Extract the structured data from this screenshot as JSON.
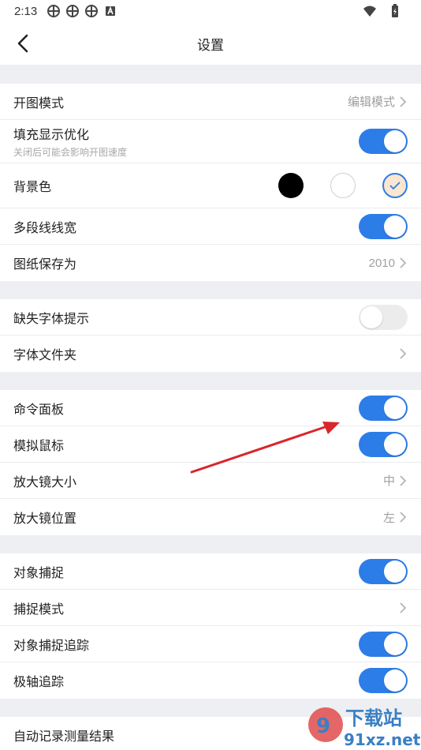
{
  "status_bar": {
    "time": "2:13"
  },
  "header": {
    "title": "设置"
  },
  "sections": [
    {
      "items": [
        {
          "label": "开图模式",
          "value": "编辑模式"
        },
        {
          "label": "填充显示优化",
          "sublabel": "关闭后可能会影响开图速度",
          "toggle": true
        },
        {
          "label": "背景色",
          "swatches": [
            "#000000",
            "#ffffff",
            "#fbe6cf"
          ],
          "selected": 2
        },
        {
          "label": "多段线线宽",
          "toggle": true
        },
        {
          "label": "图纸保存为",
          "value": "2010"
        }
      ]
    },
    {
      "items": [
        {
          "label": "缺失字体提示",
          "toggle": false
        },
        {
          "label": "字体文件夹"
        }
      ]
    },
    {
      "items": [
        {
          "label": "命令面板",
          "toggle": true
        },
        {
          "label": "模拟鼠标",
          "toggle": true
        },
        {
          "label": "放大镜大小",
          "value": "中"
        },
        {
          "label": "放大镜位置",
          "value": "左"
        }
      ]
    },
    {
      "items": [
        {
          "label": "对象捕捉",
          "toggle": true
        },
        {
          "label": "捕捉模式"
        },
        {
          "label": "对象捕捉追踪",
          "toggle": true
        },
        {
          "label": "极轴追踪",
          "toggle": true
        }
      ]
    },
    {
      "items": [
        {
          "label": "自动记录测量结果"
        }
      ]
    }
  ],
  "watermark": {
    "brand": "下载站",
    "domain": "91xz.net"
  },
  "colors": {
    "accent": "#2d7de8",
    "annotation_arrow": "#d9262a",
    "watermark": "#3a7fc4"
  }
}
